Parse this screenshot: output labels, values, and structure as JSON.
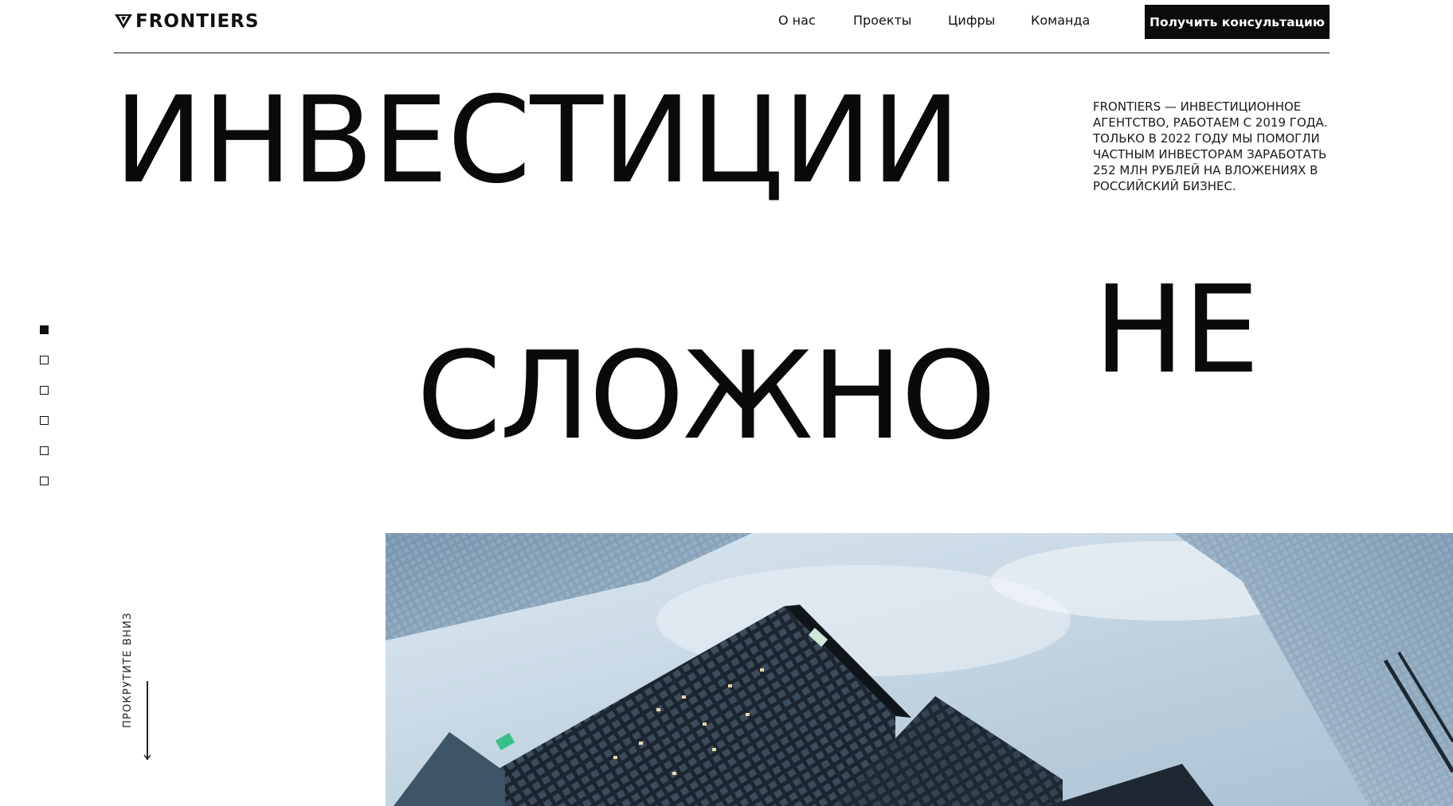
{
  "header": {
    "logo_text": "FRONTIERS",
    "logo_icon": "triangle-logo-icon",
    "nav": [
      {
        "label": "О нас"
      },
      {
        "label": "Проекты"
      },
      {
        "label": "Цифры"
      },
      {
        "label": "Команда"
      }
    ],
    "cta_label": "Получить консультацию"
  },
  "hero": {
    "words": [
      "ИНВЕСТИЦИИ",
      "СЛОЖНО",
      "НЕ"
    ],
    "intro": "FRONTIERS — инвестиционное агентство, работаем с 2019 года. Только в 2022 году мы помогли частным инвесторам заработать 252 млн рублей на вложениях в российский бизнес."
  },
  "slider": {
    "dots": 6,
    "active_index": 0
  },
  "scroll_hint": {
    "label": "ПРОКРУТИТЕ ВНИЗ",
    "icon": "arrow-down-icon"
  },
  "colors": {
    "text": "#0d0d0d",
    "background": "#ffffff",
    "button": "#0b0b0b",
    "button_text": "#ffffff"
  }
}
